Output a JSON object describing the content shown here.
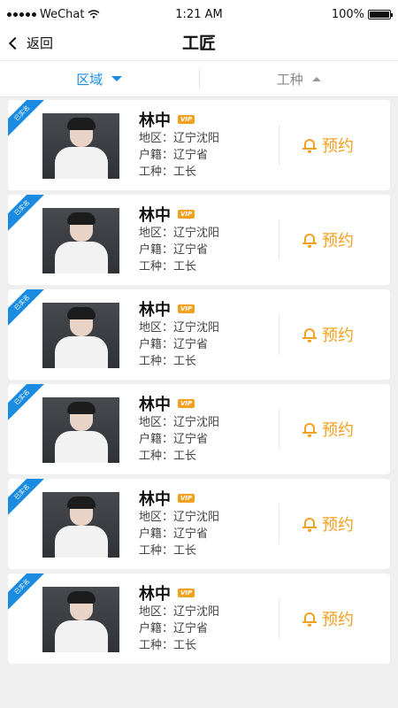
{
  "status_bar": {
    "carrier": "WeChat",
    "time": "1:21 AM",
    "battery": "100%",
    "battery_level": 1.0
  },
  "nav": {
    "back_label": "返回",
    "title": "工匠"
  },
  "filters": {
    "area_label": "区域",
    "trade_label": "工种"
  },
  "ribbon_label": "已实名",
  "vip_label": "VIP",
  "book_label": "预约",
  "workers": [
    {
      "name": "林中",
      "region": "地区：辽宁沈阳",
      "hometown": "户籍：辽宁省",
      "trade": "工种：工长"
    },
    {
      "name": "林中",
      "region": "地区：辽宁沈阳",
      "hometown": "户籍：辽宁省",
      "trade": "工种：工长"
    },
    {
      "name": "林中",
      "region": "地区：辽宁沈阳",
      "hometown": "户籍：辽宁省",
      "trade": "工种：工长"
    },
    {
      "name": "林中",
      "region": "地区：辽宁沈阳",
      "hometown": "户籍：辽宁省",
      "trade": "工种：工长"
    },
    {
      "name": "林中",
      "region": "地区：辽宁沈阳",
      "hometown": "户籍：辽宁省",
      "trade": "工种：工长"
    },
    {
      "name": "林中",
      "region": "地区：辽宁沈阳",
      "hometown": "户籍：辽宁省",
      "trade": "工种：工长"
    }
  ],
  "colors": {
    "accent_blue": "#1a8be0",
    "accent_orange": "#f2a020",
    "background": "#efefef"
  },
  "icons": {
    "back": "chevron-left-icon",
    "filter_down": "caret-down-icon",
    "filter_up": "caret-up-icon",
    "book": "bell-icon",
    "verified": "verified-ribbon"
  }
}
